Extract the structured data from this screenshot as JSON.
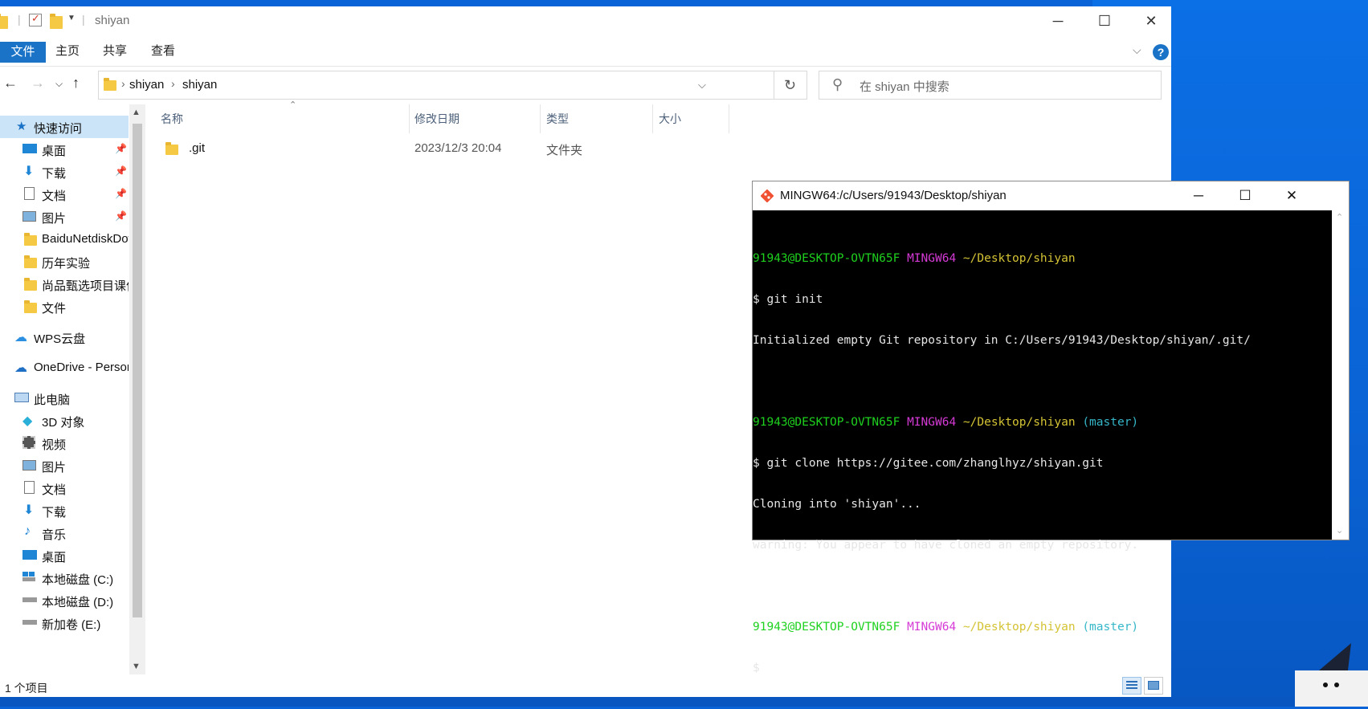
{
  "explorer": {
    "title": "shiyan",
    "ribbon_tabs": [
      "文件",
      "主页",
      "共享",
      "查看"
    ],
    "help": "?",
    "address": {
      "crumbs": [
        "shiyan",
        "shiyan"
      ],
      "separator": "›"
    },
    "search_placeholder": "在 shiyan 中搜索",
    "columns": [
      "名称",
      "修改日期",
      "类型",
      "大小"
    ],
    "files": [
      {
        "name": ".git",
        "modified": "2023/12/3 20:04",
        "type": "文件夹",
        "size": ""
      }
    ],
    "sidebar": {
      "quick_access": "快速访问",
      "pinned": [
        "桌面",
        "下载",
        "文档",
        "图片"
      ],
      "folders": [
        "BaiduNetdiskDownload",
        "历年实验",
        "尚品甄选项目课件",
        "文件"
      ],
      "wps": "WPS云盘",
      "onedrive": "OneDrive - Personal",
      "this_pc": "此电脑",
      "pc_items": [
        "3D 对象",
        "视频",
        "图片",
        "文档",
        "下载",
        "音乐",
        "桌面",
        "本地磁盘 (C:)",
        "本地磁盘 (D:)",
        "新加卷 (E:)"
      ]
    },
    "status": "1 个项目"
  },
  "terminal": {
    "title": "MINGW64:/c/Users/91943/Desktop/shiyan",
    "prompt_user": "91943@DESKTOP-OVTN65F",
    "prompt_env": "MINGW64",
    "prompt_path": "~/Desktop/shiyan",
    "branch": "(master)",
    "cmd1": "$ git init",
    "out1": "Initialized empty Git repository in C:/Users/91943/Desktop/shiyan/.git/",
    "cmd2": "$ git clone https://gitee.com/zhanglhyz/shiyan.git",
    "out2": "Cloning into 'shiyan'...",
    "out3": "warning: You appear to have cloned an empty repository.",
    "cmd3": "$"
  },
  "colors": {
    "desktop": "#0a64d8",
    "accent": "#1a73c7",
    "prompt_user": "#1fd11f",
    "prompt_env": "#d63ad6",
    "prompt_path": "#d4c334",
    "branch": "#36b7c9"
  }
}
